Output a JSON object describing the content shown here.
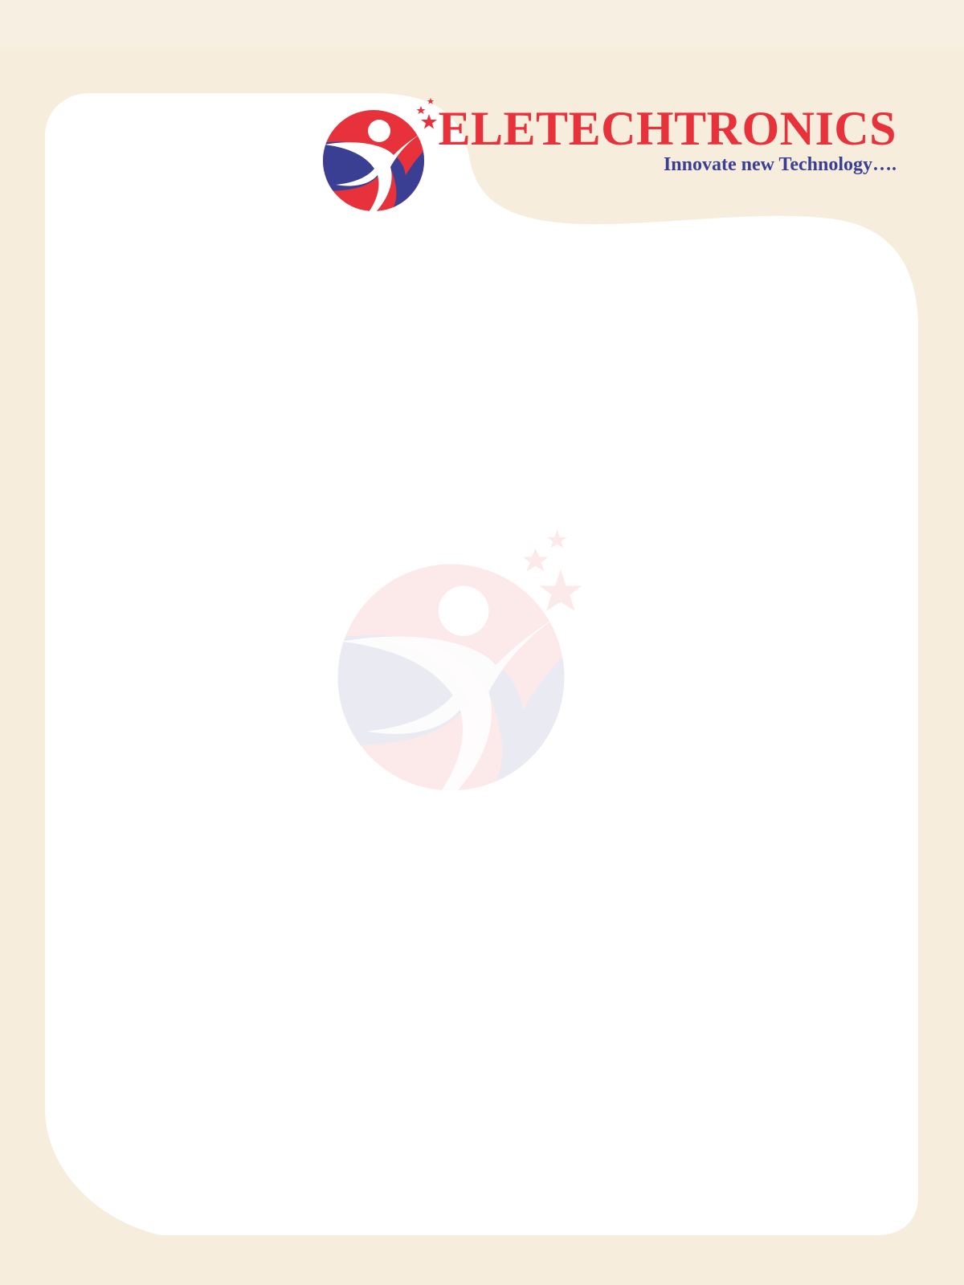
{
  "brand": {
    "name": "ELETECHTRONICS",
    "tagline": "Innovate new Technology…."
  },
  "colors": {
    "background": "#f6eddc",
    "sheet": "#ffffff",
    "brand_red": "#e8323b",
    "brand_blue": "#3b3f94"
  },
  "icons": {
    "logo": "leaping-figure-with-stars-logo",
    "watermark": "leaping-figure-with-stars-watermark"
  }
}
